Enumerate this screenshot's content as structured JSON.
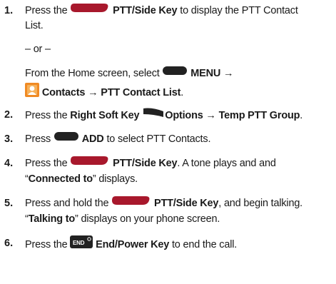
{
  "steps": [
    {
      "num": "1.",
      "l1": {
        "pre": "Press the",
        "key": "PTT/Side Key",
        "post": "to display the PTT Contact"
      },
      "l2": "List.",
      "or": "– or –",
      "l4": {
        "pre": "From the Home screen, select",
        "key": "MENU →"
      },
      "l5": {
        "key": "Contacts → PTT Contact List",
        "post": "."
      }
    },
    {
      "num": "2.",
      "pre": "Press the",
      "key1": "Right Soft Key",
      "key2": "Options → Temp PTT Group",
      "post": "."
    },
    {
      "num": "3.",
      "pre": "Press",
      "key": "ADD",
      "post": "to select PTT Contacts."
    },
    {
      "num": "4.",
      "l1": {
        "pre": "Press the",
        "key": "PTT/Side Key",
        "post": ". A tone plays and and"
      },
      "l2": {
        "open": "“",
        "key": "Connected to",
        "post": "” displays."
      }
    },
    {
      "num": "5.",
      "l1": {
        "pre": "Press and hold the",
        "key": "PTT/Side Key",
        "post": ", and begin talking."
      },
      "l2": {
        "open": "“",
        "key": "Talking to",
        "post": "” displays on your phone screen."
      }
    },
    {
      "num": "6.",
      "pre": "Press the",
      "key": "End/Power Key",
      "post": "to end the call."
    }
  ],
  "icons": {
    "ptt_color": "#a8182c",
    "menu_color": "#222222",
    "end_label": "END"
  }
}
